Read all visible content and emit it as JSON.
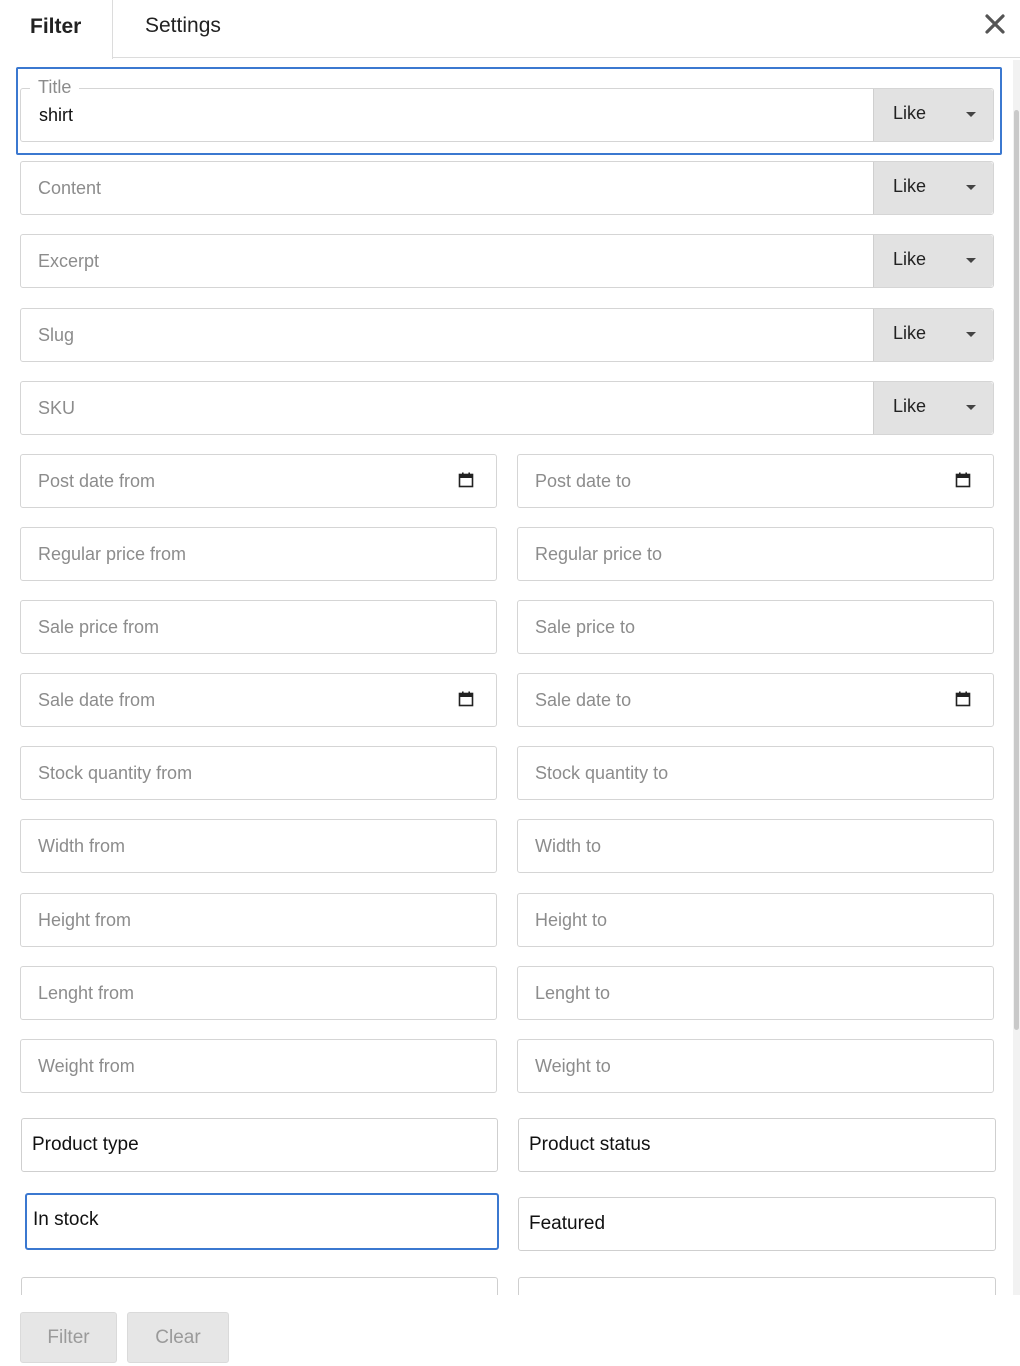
{
  "tabs": {
    "filter": "Filter",
    "settings": "Settings"
  },
  "title_field": {
    "legend": "Title",
    "value": "shirt",
    "operator": "Like"
  },
  "text_filters": [
    {
      "placeholder": "Content",
      "operator": "Like"
    },
    {
      "placeholder": "Excerpt",
      "operator": "Like"
    },
    {
      "placeholder": "Slug",
      "operator": "Like"
    },
    {
      "placeholder": "SKU",
      "operator": "Like"
    }
  ],
  "range_filters": [
    {
      "from": "Post date from",
      "to": "Post date to",
      "date": true
    },
    {
      "from": "Regular price from",
      "to": "Regular price to",
      "date": false
    },
    {
      "from": "Sale price from",
      "to": "Sale price to",
      "date": false
    },
    {
      "from": "Sale date from",
      "to": "Sale date to",
      "date": true
    },
    {
      "from": "Stock quantity from",
      "to": "Stock quantity to",
      "date": false
    },
    {
      "from": "Width from",
      "to": "Width to",
      "date": false
    },
    {
      "from": "Height from",
      "to": "Height to",
      "date": false
    },
    {
      "from": "Lenght from",
      "to": "Lenght to",
      "date": false
    },
    {
      "from": "Weight from",
      "to": "Weight to",
      "date": false
    }
  ],
  "selects": {
    "product_type": "Product type",
    "product_status": "Product status",
    "in_stock": "In stock",
    "featured": "Featured"
  },
  "buttons": {
    "filter": "Filter",
    "clear": "Clear"
  },
  "icons": {
    "close": "close-icon",
    "calendar": "calendar-icon",
    "caret": "caret-down-icon"
  },
  "colors": {
    "focus": "#3b78d0",
    "operator_bg": "#e2e2e2"
  }
}
